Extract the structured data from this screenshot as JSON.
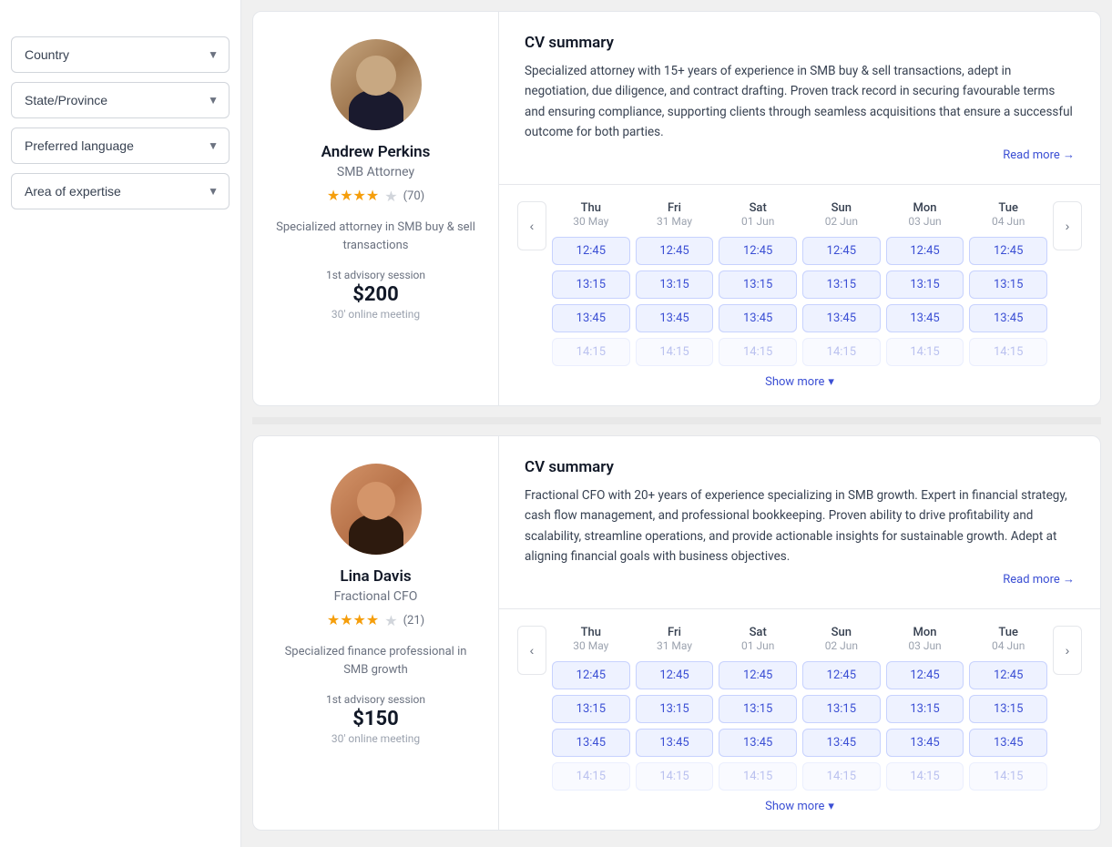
{
  "sidebar": {
    "filters": [
      {
        "id": "country",
        "label": "Country",
        "placeholder": "Country"
      },
      {
        "id": "state",
        "label": "State/Province",
        "placeholder": "State/Province"
      },
      {
        "id": "language",
        "label": "Preferred language",
        "placeholder": "Preferred language"
      },
      {
        "id": "expertise",
        "label": "Area of expertise",
        "placeholder": "Area of expertise"
      }
    ]
  },
  "experts": [
    {
      "id": "andrew-perkins",
      "name": "Andrew Perkins",
      "title": "SMB Attorney",
      "stars": 4,
      "starDisplay": "★★★★★",
      "reviewCount": "(70)",
      "description": "Specialized attorney in SMB buy & sell transactions",
      "sessionLabel": "1st advisory session",
      "price": "$200",
      "sessionType": "30' online meeting",
      "cv": {
        "title": "CV summary",
        "text": "Specialized attorney with 15+ years of experience in SMB buy & sell transactions, adept in negotiation, due diligence, and contract drafting. Proven track record in securing favourable terms and ensuring compliance, supporting clients through seamless acquisitions that ensure a successful outcome for both parties.",
        "readMore": "Read more →"
      },
      "calendar": {
        "days": [
          {
            "name": "Thu",
            "date": "30 May"
          },
          {
            "name": "Fri",
            "date": "31 May"
          },
          {
            "name": "Sat",
            "date": "01 Jun"
          },
          {
            "name": "Sun",
            "date": "02 Jun"
          },
          {
            "name": "Mon",
            "date": "03 Jun"
          },
          {
            "name": "Tue",
            "date": "04 Jun"
          }
        ],
        "timeSlots": [
          "12:45",
          "13:15",
          "13:45"
        ],
        "showMore": "Show more"
      }
    },
    {
      "id": "lina-davis",
      "name": "Lina Davis",
      "title": "Fractional CFO",
      "stars": 4,
      "starDisplay": "★★★★★",
      "reviewCount": "(21)",
      "description": "Specialized finance professional in SMB growth",
      "sessionLabel": "1st advisory session",
      "price": "$150",
      "sessionType": "30' online meeting",
      "cv": {
        "title": "CV summary",
        "text": "Fractional CFO with 20+ years of experience specializing in SMB growth. Expert in financial strategy, cash flow management, and professional bookkeeping. Proven ability to drive profitability and scalability, streamline operations, and provide actionable insights for sustainable growth. Adept at aligning financial goals with business objectives.",
        "readMore": "Read more →"
      },
      "calendar": {
        "days": [
          {
            "name": "Thu",
            "date": "30 May"
          },
          {
            "name": "Fri",
            "date": "31 May"
          },
          {
            "name": "Sat",
            "date": "01 Jun"
          },
          {
            "name": "Sun",
            "date": "02 Jun"
          },
          {
            "name": "Mon",
            "date": "03 Jun"
          },
          {
            "name": "Tue",
            "date": "04 Jun"
          }
        ],
        "timeSlots": [
          "12:45",
          "13:15",
          "13:45"
        ],
        "showMore": "Show more"
      }
    }
  ]
}
